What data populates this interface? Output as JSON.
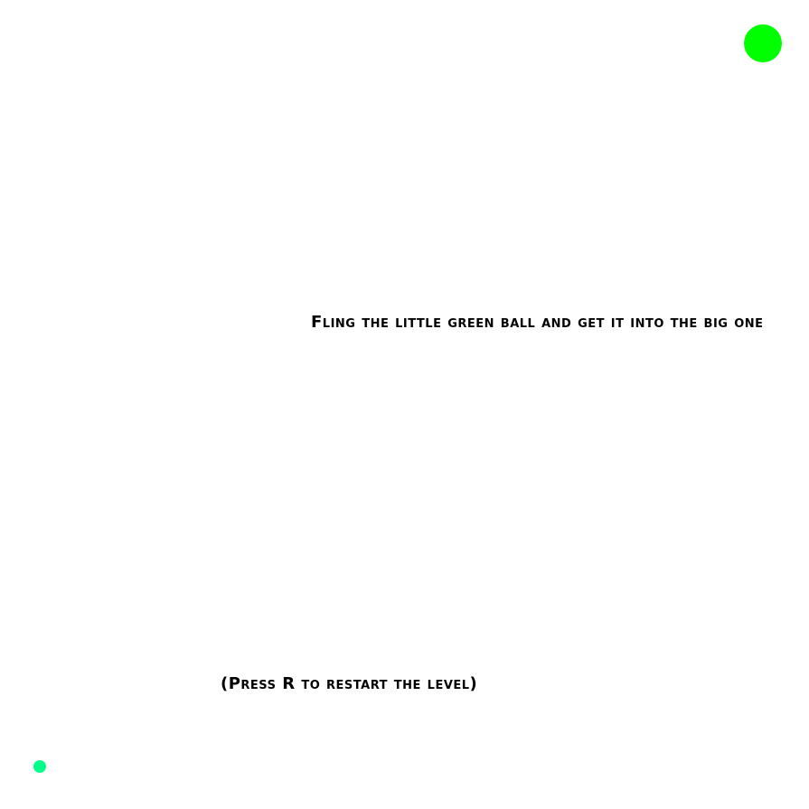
{
  "instruction": "Fling the little green ball and get it into the big one",
  "restart_hint": "(Press R to restart the level)",
  "colors": {
    "goal_ball": "#00ff00",
    "player_ball": "#00ff88",
    "background": "#ffffff",
    "text": "#000000"
  }
}
